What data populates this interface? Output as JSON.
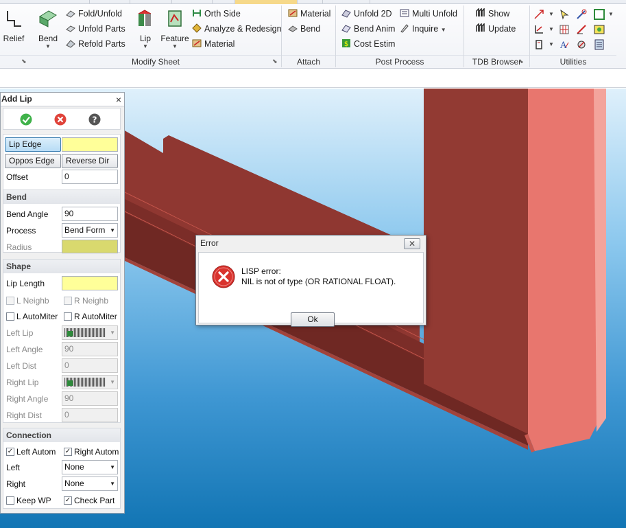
{
  "ribbon": {
    "relief": "Relief",
    "bend": "Bend",
    "fold_unfold": "Fold/Unfold",
    "unfold_parts": "Unfold Parts",
    "refold_parts": "Refold Parts",
    "lip": "Lip",
    "feature": "Feature",
    "orth_side": "Orth Side",
    "analyze_redesign": "Analyze & Redesign",
    "material_ms": "Material",
    "attach_material": "Material",
    "attach_bend": "Bend",
    "unfold_2d": "Unfold 2D",
    "multi_unfold": "Multi Unfold",
    "bend_anim": "Bend Anim",
    "inquire": "Inquire",
    "cost_estim": "Cost Estim",
    "show": "Show",
    "update": "Update",
    "groups": {
      "modify_sheet": "Modify Sheet",
      "attach": "Attach",
      "post_process": "Post Process",
      "tdb_browser": "TDB Browser",
      "utilities": "Utilities"
    }
  },
  "panel": {
    "title": "Add Lip",
    "close": "×",
    "lip_edge": "Lip Edge",
    "oppos_edge": "Oppos Edge",
    "reverse_dir": "Reverse Dir",
    "offset_label": "Offset",
    "offset_value": "0",
    "bend": {
      "header": "Bend",
      "angle_label": "Bend Angle",
      "angle_value": "90",
      "process_label": "Process",
      "process_value": "Bend Form",
      "radius_label": "Radius"
    },
    "shape": {
      "header": "Shape",
      "lip_length_label": "Lip Length",
      "l_neighb": "L Neighb",
      "r_neighb": "R Neighb",
      "l_autominer": "L AutoMiter",
      "r_autominer": "R AutoMiter",
      "left_lip_label": "Left Lip",
      "left_angle_label": "Left Angle",
      "left_angle_value": "90",
      "left_dist_label": "Left Dist",
      "left_dist_value": "0",
      "right_lip_label": "Right Lip",
      "right_angle_label": "Right Angle",
      "right_angle_value": "90",
      "right_dist_label": "Right Dist",
      "right_dist_value": "0"
    },
    "connection": {
      "header": "Connection",
      "left_autom": "Left Autom",
      "right_autom": "Right Autom",
      "left_label": "Left",
      "left_value": "None",
      "right_label": "Right",
      "right_value": "None",
      "keep_wp": "Keep WP",
      "check_part": "Check Part"
    }
  },
  "dialog": {
    "title": "Error",
    "line1": "LISP error:",
    "line2": "NIL is not of type (OR RATIONAL FLOAT).",
    "ok": "Ok"
  },
  "colors": {
    "part_dark": "#943a33",
    "part_light": "#e8766e",
    "error_red": "#d9332e"
  }
}
